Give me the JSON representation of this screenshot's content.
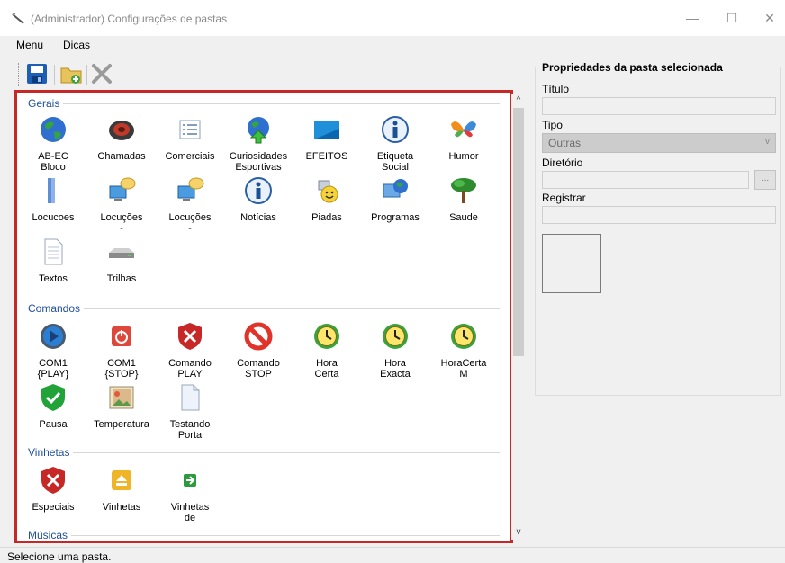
{
  "window": {
    "title": "(Administrador) Configurações de pastas",
    "minimize": "—",
    "maximize": "☐",
    "close": "✕"
  },
  "menu": {
    "items": [
      "Menu",
      "Dicas"
    ]
  },
  "toolbar": {
    "icons": [
      "save-icon",
      "add-folder-icon",
      "delete-icon"
    ]
  },
  "groups": [
    {
      "title": "Gerais",
      "items": [
        {
          "label": "AB-EC\nBloco",
          "icon": "globe-icon"
        },
        {
          "label": "Chamadas",
          "icon": "speaker-icon"
        },
        {
          "label": "Comerciais",
          "icon": "list-document-icon"
        },
        {
          "label": "Curiosidades\nEsportivas",
          "icon": "globe-arrow-icon"
        },
        {
          "label": "EFEITOS",
          "icon": "blue-screen-icon"
        },
        {
          "label": "Etiqueta\nSocial",
          "icon": "info-icon"
        },
        {
          "label": "Humor",
          "icon": "butterfly-icon"
        },
        {
          "label": "Locucoes",
          "icon": "blue-folder-icon"
        },
        {
          "label": "Locuções\n-",
          "icon": "computer-chat-icon"
        },
        {
          "label": "Locuções\n-",
          "icon": "computer-chat-icon"
        },
        {
          "label": "Notícias",
          "icon": "info-icon"
        },
        {
          "label": "Piadas",
          "icon": "smiley-icon"
        },
        {
          "label": "Programas",
          "icon": "programs-icon"
        },
        {
          "label": "Saude",
          "icon": "tree-icon"
        },
        {
          "label": "Textos",
          "icon": "text-file-icon"
        },
        {
          "label": "Trilhas",
          "icon": "drive-icon"
        }
      ]
    },
    {
      "title": "Comandos",
      "items": [
        {
          "label": "COM1\n{PLAY}",
          "icon": "play-icon"
        },
        {
          "label": "COM1\n{STOP}",
          "icon": "power-stop-icon"
        },
        {
          "label": "Comando\nPLAY",
          "icon": "shield-x-icon"
        },
        {
          "label": "Comando\nSTOP",
          "icon": "no-entry-icon"
        },
        {
          "label": "Hora\nCerta",
          "icon": "clock-icon"
        },
        {
          "label": "Hora\nExacta",
          "icon": "clock-icon"
        },
        {
          "label": "HoraCerta\nM",
          "icon": "clock-icon"
        },
        {
          "label": "Pausa",
          "icon": "shield-check-icon"
        },
        {
          "label": "Temperatura",
          "icon": "picture-icon"
        },
        {
          "label": "Testando\nPorta",
          "icon": "blank-file-icon"
        }
      ]
    },
    {
      "title": "Vinhetas",
      "items": [
        {
          "label": "Especiais",
          "icon": "shield-x-icon"
        },
        {
          "label": "Vinhetas",
          "icon": "eject-icon"
        },
        {
          "label": "Vinhetas\nde",
          "icon": "enter-arrow-icon"
        }
      ]
    },
    {
      "title": "Músicas",
      "items": []
    }
  ],
  "properties": {
    "title": "Propriedades da pasta selecionada",
    "titulo_label": "Título",
    "titulo_value": "",
    "tipo_label": "Tipo",
    "tipo_value": "Outras",
    "diretorio_label": "Diretório",
    "diretorio_value": "",
    "browse_label": "...",
    "registrar_label": "Registrar",
    "registrar_value": ""
  },
  "status": {
    "text": "Selecione uma pasta."
  },
  "colors": {
    "highlight_border": "#c62828",
    "group_title": "#1f4fa0"
  }
}
